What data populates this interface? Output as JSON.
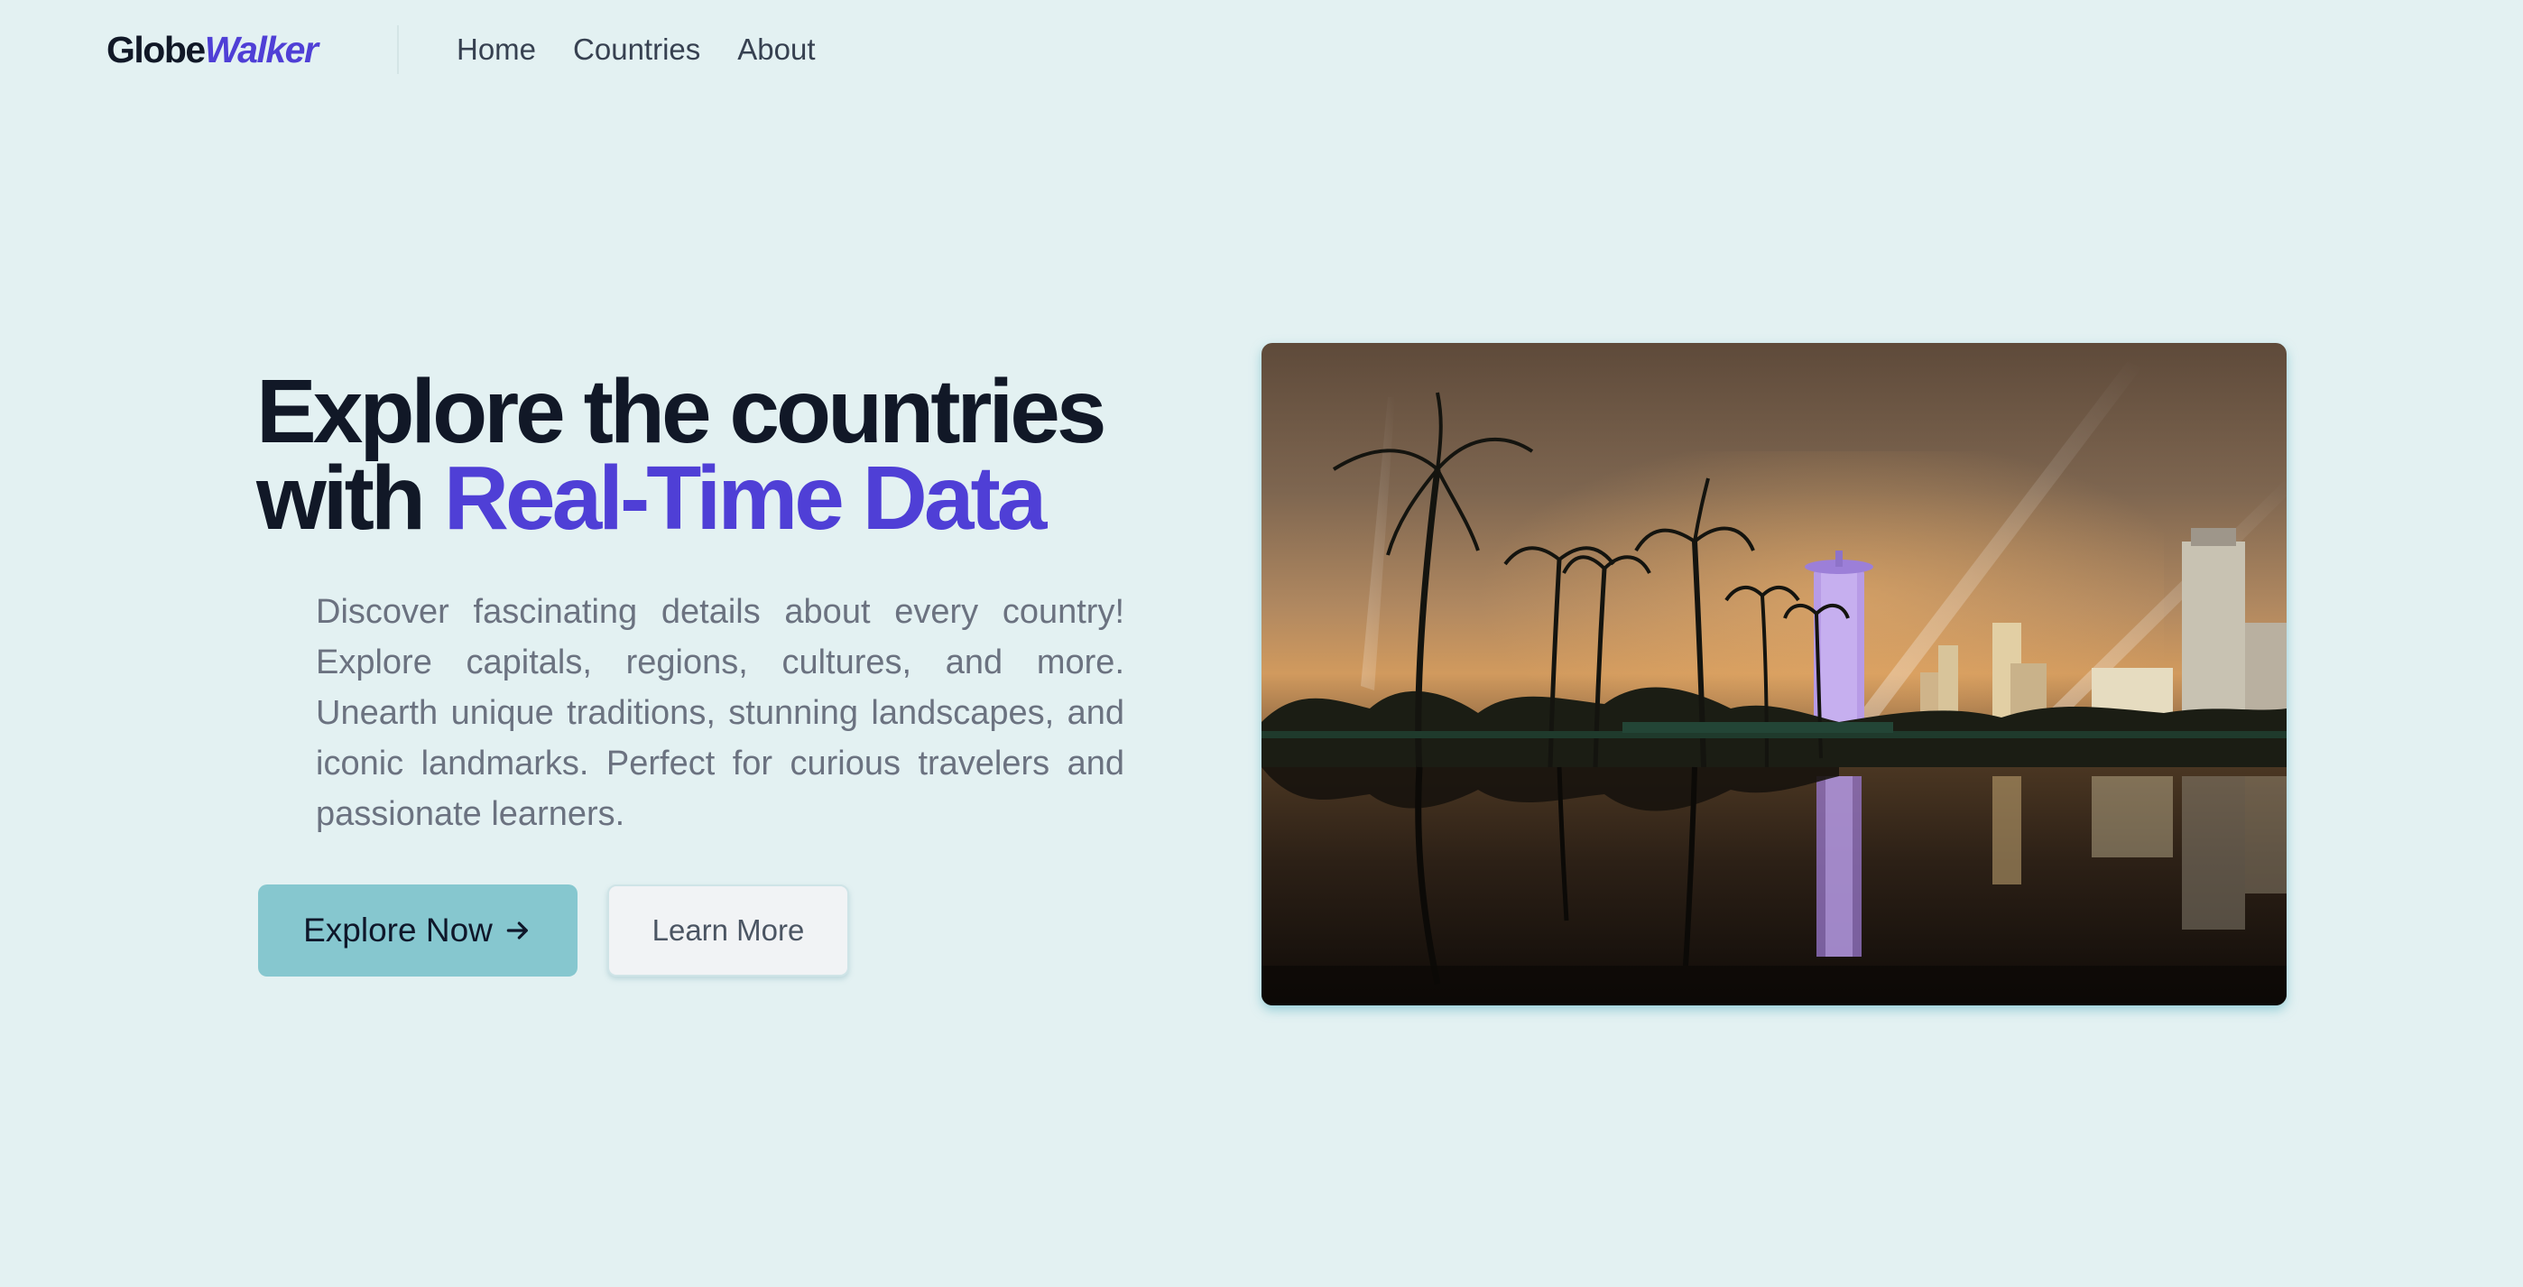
{
  "brand": {
    "part1": "Globe",
    "part2": "Walker"
  },
  "nav": {
    "items": [
      {
        "label": "Home"
      },
      {
        "label": "Countries"
      },
      {
        "label": "About"
      }
    ]
  },
  "hero": {
    "title_line1": "Explore the countries",
    "title_line2_prefix": "with ",
    "title_line2_accent": "Real-Time Data",
    "description": "Discover fascinating details about every country! Explore capitals, regions, cultures, and more. Unearth unique traditions, stunning landscapes, and iconic landmarks. Perfect for curious travelers and passionate learners.",
    "primary_button": "Explore Now",
    "secondary_button": "Learn More"
  },
  "colors": {
    "background": "#e3f1f2",
    "accent": "#4f3fd6",
    "primary_button": "#86c7cf",
    "heading": "#111827"
  },
  "icons": {
    "primary_button_icon": "arrow-right-icon"
  }
}
